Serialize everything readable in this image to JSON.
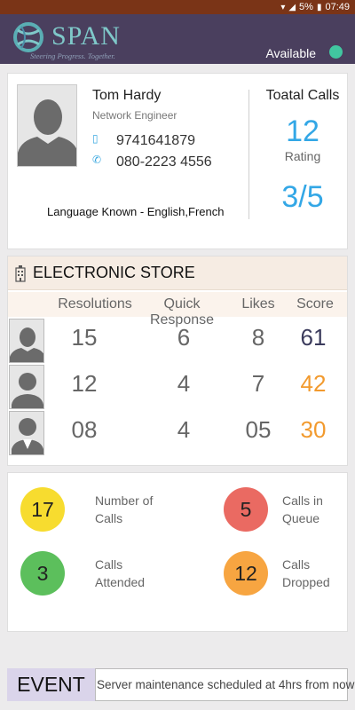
{
  "status_bar": {
    "battery": "5%",
    "time": "07:49"
  },
  "app": {
    "logo_text": "SPAN",
    "logo_tagline": "Steering Progress. Together.",
    "availability": "Available",
    "availability_color": "#41c6a0"
  },
  "profile": {
    "name": "Tom Hardy",
    "role": "Network Engineer",
    "mobile": "9741641879",
    "landline": "080-2223 4556",
    "languages": "Language Known - English,French",
    "calls_title": "Toatal Calls",
    "calls_value": "12",
    "rating_label": "Rating",
    "rating_value": "3/5"
  },
  "store": {
    "title": "ELECTRONIC STORE",
    "columns": [
      "Resolutions",
      "Quick Response",
      "Likes",
      "Score"
    ],
    "rows": [
      {
        "resolutions": "15",
        "quick_response": "6",
        "likes": "8",
        "score": "61",
        "score_color": "#3b3b5c"
      },
      {
        "resolutions": "12",
        "quick_response": "4",
        "likes": "7",
        "score": "42",
        "score_color": "#f29a2e"
      },
      {
        "resolutions": "08",
        "quick_response": "4",
        "likes": "05",
        "score": "30",
        "score_color": "#f29a2e"
      }
    ]
  },
  "kpis": [
    {
      "value": "17",
      "label": "Number of Calls",
      "color": "#f7dc2f"
    },
    {
      "value": "5",
      "label": "Calls in Queue",
      "color": "#ea6a62"
    },
    {
      "value": "3",
      "label": "Calls Attended",
      "color": "#5cbf5c"
    },
    {
      "value": "12",
      "label": "Calls Dropped",
      "color": "#f7a541"
    }
  ],
  "event": {
    "label": "EVENT",
    "message": "Server maintenance scheduled at 4hrs from now"
  }
}
